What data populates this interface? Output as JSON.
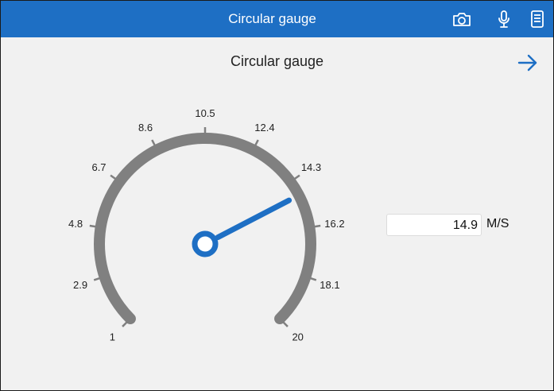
{
  "nav": {
    "title": "Circular gauge",
    "icons": [
      "camera-icon",
      "microphone-icon",
      "document-icon"
    ]
  },
  "page": {
    "title": "Circular gauge",
    "next_icon": "arrow-right-icon"
  },
  "gauge": {
    "min": 1,
    "max": 20,
    "value": 14.9,
    "tick_labels": [
      "1",
      "2.9",
      "4.8",
      "6.7",
      "8.6",
      "10.5",
      "12.4",
      "14.3",
      "16.2",
      "18.1",
      "20"
    ],
    "colors": {
      "scale": "#808080",
      "needle": "#1e6fc4",
      "label": "#222222"
    }
  },
  "readout": {
    "value": "14.9",
    "unit": "M/S"
  },
  "colors": {
    "nav_background": "#1e6fc4",
    "page_background": "#f1f1f1",
    "accent": "#1e6fc4"
  }
}
